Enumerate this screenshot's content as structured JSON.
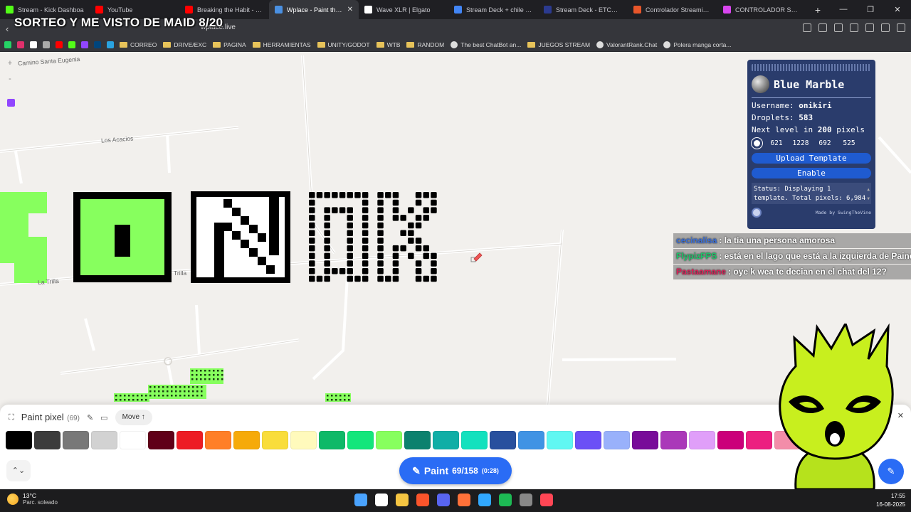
{
  "overlay_title": "SORTEO Y ME VISTO DE MAID 8/20",
  "tabs": [
    {
      "label": "Stream - Kick Dashboa",
      "color": "#53fc18",
      "active": false
    },
    {
      "label": "YouTube",
      "color": "#ff0000",
      "active": false
    },
    {
      "label": "Breaking the Habit - YouTu",
      "color": "#ff0000",
      "active": false
    },
    {
      "label": "Wplace - Paint the wo",
      "color": "#4a90e2",
      "active": true
    },
    {
      "label": "Wave XLR | Elgato",
      "color": "#ffffff",
      "active": false
    },
    {
      "label": "Stream Deck + chile - Busc",
      "color": "#4285f4",
      "active": false
    },
    {
      "label": "Stream Deck - ETCHILE",
      "color": "#2b3a8f",
      "active": false
    },
    {
      "label": "Controlador Streaming El",
      "color": "#e8562a",
      "active": false
    },
    {
      "label": "CONTROLADOR STREAMI",
      "color": "#d946ef",
      "active": false
    }
  ],
  "url": "wplace.live",
  "bookmarks": [
    {
      "label": "CORREO",
      "folder": true
    },
    {
      "label": "DRIVE/EXC",
      "folder": true
    },
    {
      "label": "PAGINA",
      "folder": true
    },
    {
      "label": "HERRAMIENTAS",
      "folder": true
    },
    {
      "label": "UNITY/GODOT",
      "folder": true
    },
    {
      "label": "WTB",
      "folder": true
    },
    {
      "label": "RANDOM",
      "folder": true
    },
    {
      "label": "The best ChatBot an...",
      "folder": false
    },
    {
      "label": "JUEGOS STREAM",
      "folder": true
    },
    {
      "label": "ValorantRank.Chat",
      "folder": false
    },
    {
      "label": "Polera manga corta...",
      "folder": false
    }
  ],
  "map": {
    "labels": [
      "Camino Santa Eugenia",
      "Los Acacios",
      "Trilla",
      "La Trilla"
    ]
  },
  "blue_marble": {
    "title": "Blue Marble",
    "username_label": "Username:",
    "username": "onikiri",
    "droplets_label": "Droplets:",
    "droplets": "583",
    "next_level_prefix": "Next level in",
    "next_level_value": "200",
    "next_level_suffix": "pixels",
    "coords": [
      "621",
      "1228",
      "692",
      "525"
    ],
    "upload_label": "Upload Template",
    "enable_label": "Enable",
    "status": "Status: Displaying 1 template. Total pixels: 6,984",
    "made_by": "Made by SwingTheVine"
  },
  "chat": [
    {
      "user": "cecinalisa",
      "user_color": "#3b6fd6",
      "text": ": la tia una persona amorosa"
    },
    {
      "user": "FlypizFPS",
      "user_color": "#1fc46a",
      "text": ": está en el lago que está a la izquierda de Paine"
    },
    {
      "user": "Pastaamane",
      "user_color": "#e0205a",
      "text": ": oye k wea te decian en el chat del 12?"
    }
  ],
  "paint_panel": {
    "title": "Paint pixel",
    "count": "(69)",
    "move_label": "Move ↑",
    "close_icon": "✕",
    "paint_label": "Paint",
    "paint_count": "69/158",
    "paint_timer": "(0:28)",
    "palette": [
      "#000000",
      "#3c3c3c",
      "#787878",
      "#d2d2d2",
      "#ffffff",
      "#600018",
      "#ed1c24",
      "#ff7f27",
      "#f6aa09",
      "#f9dd3b",
      "#fffabc",
      "#0eb968",
      "#13e67b",
      "#87ff5e",
      "#0c816e",
      "#10aea6",
      "#13e1be",
      "#28509e",
      "#4093e4",
      "#60f7f2",
      "#6b50f6",
      "#99b1fb",
      "#780c99",
      "#aa38b9",
      "#e09ff9",
      "#cb007a",
      "#ec1f80",
      "#f38da9"
    ]
  },
  "taskbar": {
    "temp": "13°C",
    "weather": "Parc. soleado",
    "time": "17:55",
    "date": "16-08-2025",
    "app_colors": [
      "#4aa3ff",
      "#ffffff",
      "#f5c542",
      "#fb542b",
      "#5865f2",
      "#ff7139",
      "#31a8ff",
      "#1db954",
      "#888888",
      "#ff4655"
    ]
  }
}
